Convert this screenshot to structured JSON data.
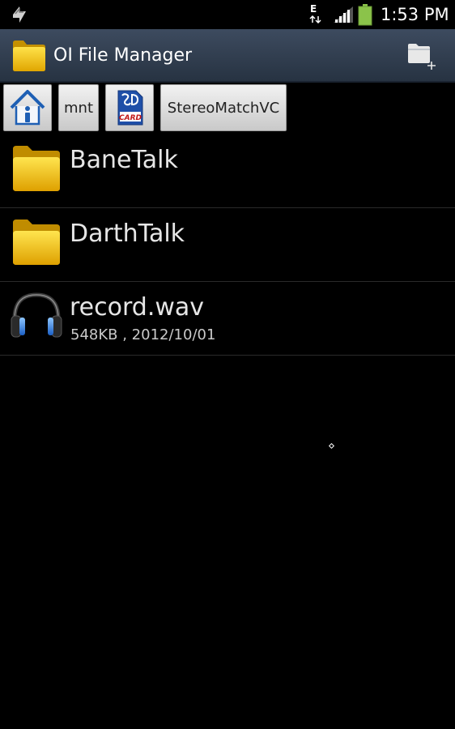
{
  "status_bar": {
    "time": "1:53 PM",
    "network_type": "E",
    "icons": [
      "sync-icon",
      "network-e-icon",
      "signal-icon",
      "battery-icon"
    ],
    "colors": {
      "battery": "#8bc34a"
    }
  },
  "action_bar": {
    "title": "OI File Manager",
    "icons": [
      "folder-icon",
      "new-folder-icon"
    ]
  },
  "breadcrumb": {
    "items": [
      {
        "label": "",
        "icon": "home-icon"
      },
      {
        "label": "mnt"
      },
      {
        "label": "",
        "icon": "sd-card-icon"
      },
      {
        "label": "StereoMatchVC"
      }
    ]
  },
  "files": [
    {
      "name": "BaneTalk",
      "type": "folder",
      "icon": "folder-icon",
      "meta": ""
    },
    {
      "name": "DarthTalk",
      "type": "folder",
      "icon": "folder-icon",
      "meta": ""
    },
    {
      "name": "record.wav",
      "type": "audio",
      "icon": "headphones-icon",
      "meta": "548KB , 2012/10/01"
    }
  ],
  "colors": {
    "action_bar_top": "#3d4b5f",
    "action_bar_bottom": "#273342",
    "folder_yellow": "#f7c400",
    "background": "#000000"
  }
}
